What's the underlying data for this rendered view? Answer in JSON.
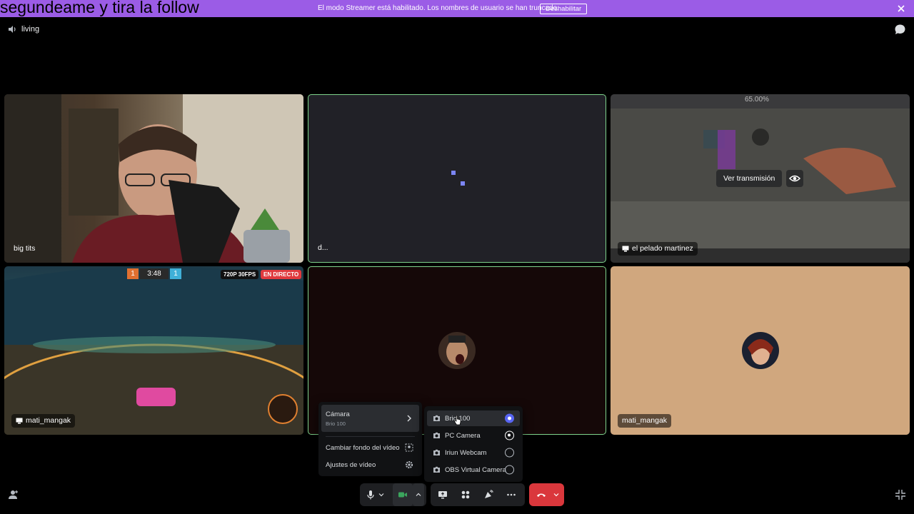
{
  "overlay_title": "segundeame y tira la follow",
  "banner": {
    "message": "El modo Streamer está habilitado. Los nombres de usuario se han truncado.",
    "disable_label": "Deshabilitar"
  },
  "channel": {
    "name": "living"
  },
  "tiles": [
    {
      "label": "big tits",
      "type": "camera"
    },
    {
      "label": "d...",
      "type": "camera-loading",
      "speaking": true
    },
    {
      "label": "el pelado martinez",
      "type": "stream",
      "view_stream_label": "Ver transmisión",
      "game_progress": "65.00%"
    },
    {
      "label": "mati_mangak",
      "type": "stream",
      "resolution_badge": "720P 30FPS",
      "live_badge": "EN DIRECTO",
      "score_left": "1",
      "score_time": "3:48",
      "score_right": "1"
    },
    {
      "label": "",
      "type": "avatar",
      "speaking": true
    },
    {
      "label": "mati_mangak",
      "type": "avatar"
    }
  ],
  "video_menu": {
    "camera_label": "Cámara",
    "camera_value": "Brio 100",
    "change_background_label": "Cambiar fondo del vídeo",
    "video_settings_label": "Ajustes de vídeo"
  },
  "camera_submenu": {
    "options": [
      {
        "label": "Brio 100",
        "state": "selected"
      },
      {
        "label": "PC Camera",
        "state": "active"
      },
      {
        "label": "Iriun Webcam",
        "state": "off"
      },
      {
        "label": "OBS Virtual Camera",
        "state": "off"
      }
    ]
  },
  "colors": {
    "banner": "#9b5ce6",
    "speaking_ring": "#7fd48c",
    "end_call": "#da373c",
    "radio_selected": "#5865f2",
    "video_on": "#3ba55d"
  }
}
